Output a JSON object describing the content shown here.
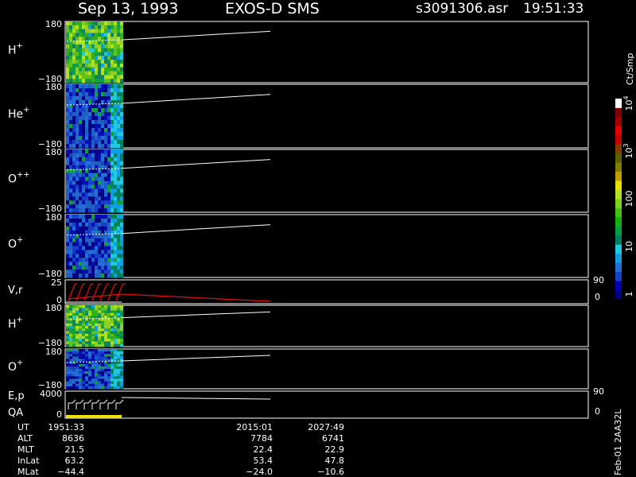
{
  "header": {
    "date": "Sep 13, 1993",
    "instrument": "EXOS-D SMS",
    "file": "s3091306.asr",
    "time": "19:51:33"
  },
  "colorbar": {
    "unit": "Ct/Smp",
    "ticks": [
      {
        "label": "1",
        "value": 1
      },
      {
        "label": "10",
        "value": 10
      },
      {
        "label": "100",
        "value": 100
      },
      {
        "label": "10",
        "sup": "3",
        "value": 1000
      },
      {
        "label": "10",
        "sup": "4",
        "value": 10000
      }
    ],
    "colors": [
      "#000080",
      "#0000b0",
      "#1840c8",
      "#2070d8",
      "#10a0e0",
      "#20c8e0",
      "#008060",
      "#00a040",
      "#10b010",
      "#40c010",
      "#80d020",
      "#b0e020",
      "#e8e000",
      "#c0a000",
      "#808000",
      "#606000",
      "#804000",
      "#c00000",
      "#e00000",
      "#a00000",
      "#800000",
      "#ffffff"
    ]
  },
  "footer": {
    "rows": [
      {
        "label": "UT",
        "values": [
          "1951:33",
          "2015:01",
          "2027:49"
        ]
      },
      {
        "label": "ALT",
        "values": [
          "8636",
          "7784",
          "6741"
        ]
      },
      {
        "label": "MLT",
        "values": [
          "21.5",
          "22.4",
          "22.9"
        ]
      },
      {
        "label": "InLat",
        "values": [
          "63.2",
          "53.4",
          "47.8"
        ]
      },
      {
        "label": "MLat",
        "values": [
          "−44.4",
          "−24.0",
          "−10.6"
        ]
      }
    ],
    "side_label": "Feb-01 2AA32L"
  },
  "chart_data": {
    "type": "heatmap",
    "panels": [
      {
        "id": "h1",
        "name": "H",
        "sup": "+",
        "ymax_label": "180",
        "ymin_label": "−180",
        "palette": "green"
      },
      {
        "id": "he",
        "name": "He",
        "sup": "+",
        "ymax_label": "180",
        "ymin_label": "−180",
        "palette": "blue"
      },
      {
        "id": "opp",
        "name": "O",
        "sup": "++",
        "ymax_label": "180",
        "ymin_label": "−180",
        "palette": "blue"
      },
      {
        "id": "op1",
        "name": "O",
        "sup": "+",
        "ymax_label": "180",
        "ymin_label": "−180",
        "palette": "blue"
      },
      {
        "id": "vr",
        "name": "V,r",
        "ymax_label": "25",
        "ymin_label": "0",
        "right_top": "90",
        "right_bottom": "0",
        "kind": "line"
      },
      {
        "id": "h2",
        "name": "H",
        "sup": "+",
        "ymax_label": "180",
        "ymin_label": "−180",
        "palette": "green"
      },
      {
        "id": "op2",
        "name": "O",
        "sup": "+",
        "ymax_label": "180",
        "ymin_label": "−180",
        "palette": "blue"
      },
      {
        "id": "ep",
        "name": "E,p",
        "name2": "QA",
        "ymax_label": "4000",
        "ymin_label": "0",
        "right_top": "90",
        "right_bottom": "0",
        "kind": "energy"
      }
    ]
  }
}
